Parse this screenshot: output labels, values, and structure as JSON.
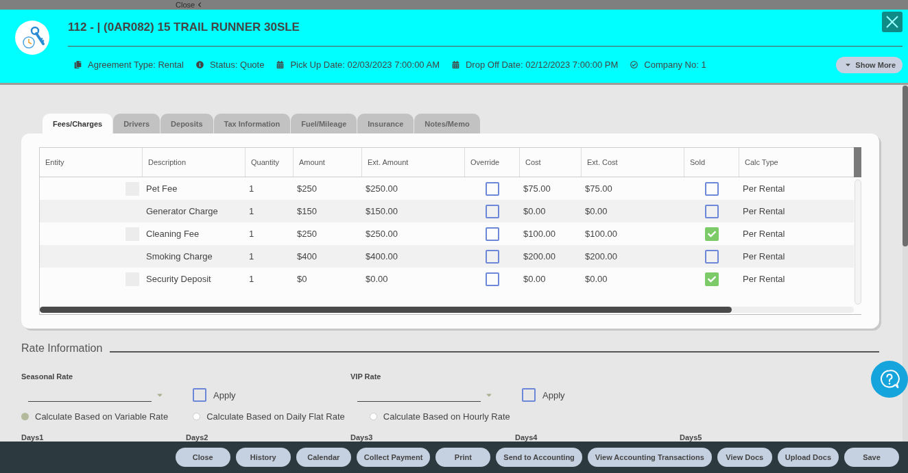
{
  "backdrop": {
    "close_link": "Close"
  },
  "header": {
    "title": "112 - | (0AR082) 15 TRAIL RUNNER 30SLE",
    "info": [
      {
        "kind": "agreement",
        "text": "Agreement Type: Rental"
      },
      {
        "kind": "status",
        "text": "Status: Quote"
      },
      {
        "kind": "date",
        "text": "Pick Up Date: 02/03/2023 7:00:00 AM"
      },
      {
        "kind": "date",
        "text": "Drop Off Date: 02/12/2023 7:00:00 PM"
      },
      {
        "kind": "company",
        "text": "Company No: 1"
      }
    ],
    "show_more": "Show More"
  },
  "tabs": [
    {
      "label": "Fees/Charges",
      "selected": true
    },
    {
      "label": "Drivers",
      "selected": false
    },
    {
      "label": "Deposits",
      "selected": false
    },
    {
      "label": "Tax Information",
      "selected": false
    },
    {
      "label": "Fuel/Mileage",
      "selected": false
    },
    {
      "label": "Insurance",
      "selected": false
    },
    {
      "label": "Notes/Memo",
      "selected": false
    }
  ],
  "table": {
    "columns": [
      "Entity",
      "Description",
      "Quantity",
      "Amount",
      "Ext. Amount",
      "Override",
      "Cost",
      "Ext. Cost",
      "Sold",
      "Calc Type"
    ],
    "rows": [
      {
        "description": "Pet Fee",
        "quantity": "1",
        "amount": "$250",
        "ext_amount": "$250.00",
        "override": false,
        "cost": "$75.00",
        "ext_cost": "$75.00",
        "sold": false,
        "calc_type": "Per Rental"
      },
      {
        "description": "Generator Charge",
        "quantity": "1",
        "amount": "$150",
        "ext_amount": "$150.00",
        "override": false,
        "cost": "$0.00",
        "ext_cost": "$0.00",
        "sold": false,
        "calc_type": "Per Rental"
      },
      {
        "description": "Cleaning Fee",
        "quantity": "1",
        "amount": "$250",
        "ext_amount": "$250.00",
        "override": false,
        "cost": "$100.00",
        "ext_cost": "$100.00",
        "sold": true,
        "calc_type": "Per Rental"
      },
      {
        "description": "Smoking Charge",
        "quantity": "1",
        "amount": "$400",
        "ext_amount": "$400.00",
        "override": false,
        "cost": "$200.00",
        "ext_cost": "$200.00",
        "sold": false,
        "calc_type": "Per Rental"
      },
      {
        "description": "Security Deposit",
        "quantity": "1",
        "amount": "$0",
        "ext_amount": "$0.00",
        "override": false,
        "cost": "$0.00",
        "ext_cost": "$0.00",
        "sold": true,
        "calc_type": "Per Rental"
      }
    ]
  },
  "rate_information": {
    "title": "Rate Information",
    "rates": [
      {
        "label": "Seasonal Rate",
        "apply": {
          "label": "Apply",
          "checked": false
        }
      },
      {
        "label": "VIP Rate",
        "apply": {
          "label": "Apply",
          "checked": false
        }
      }
    ],
    "calculation_options": [
      {
        "label": "Calculate Based on Variable Rate",
        "selected": true
      },
      {
        "label": "Calculate Based on Daily Flat Rate",
        "selected": false
      },
      {
        "label": "Calculate Based on Hourly Rate",
        "selected": false
      }
    ],
    "days": [
      "Days1",
      "Days2",
      "Days3",
      "Days4",
      "Days5"
    ]
  },
  "footer": {
    "buttons": [
      "Close",
      "History",
      "Calendar",
      "Collect Payment",
      "Print",
      "Send to Accounting",
      "View Accounting Transactions",
      "View Docs",
      "Upload Docs",
      "Save"
    ]
  }
}
